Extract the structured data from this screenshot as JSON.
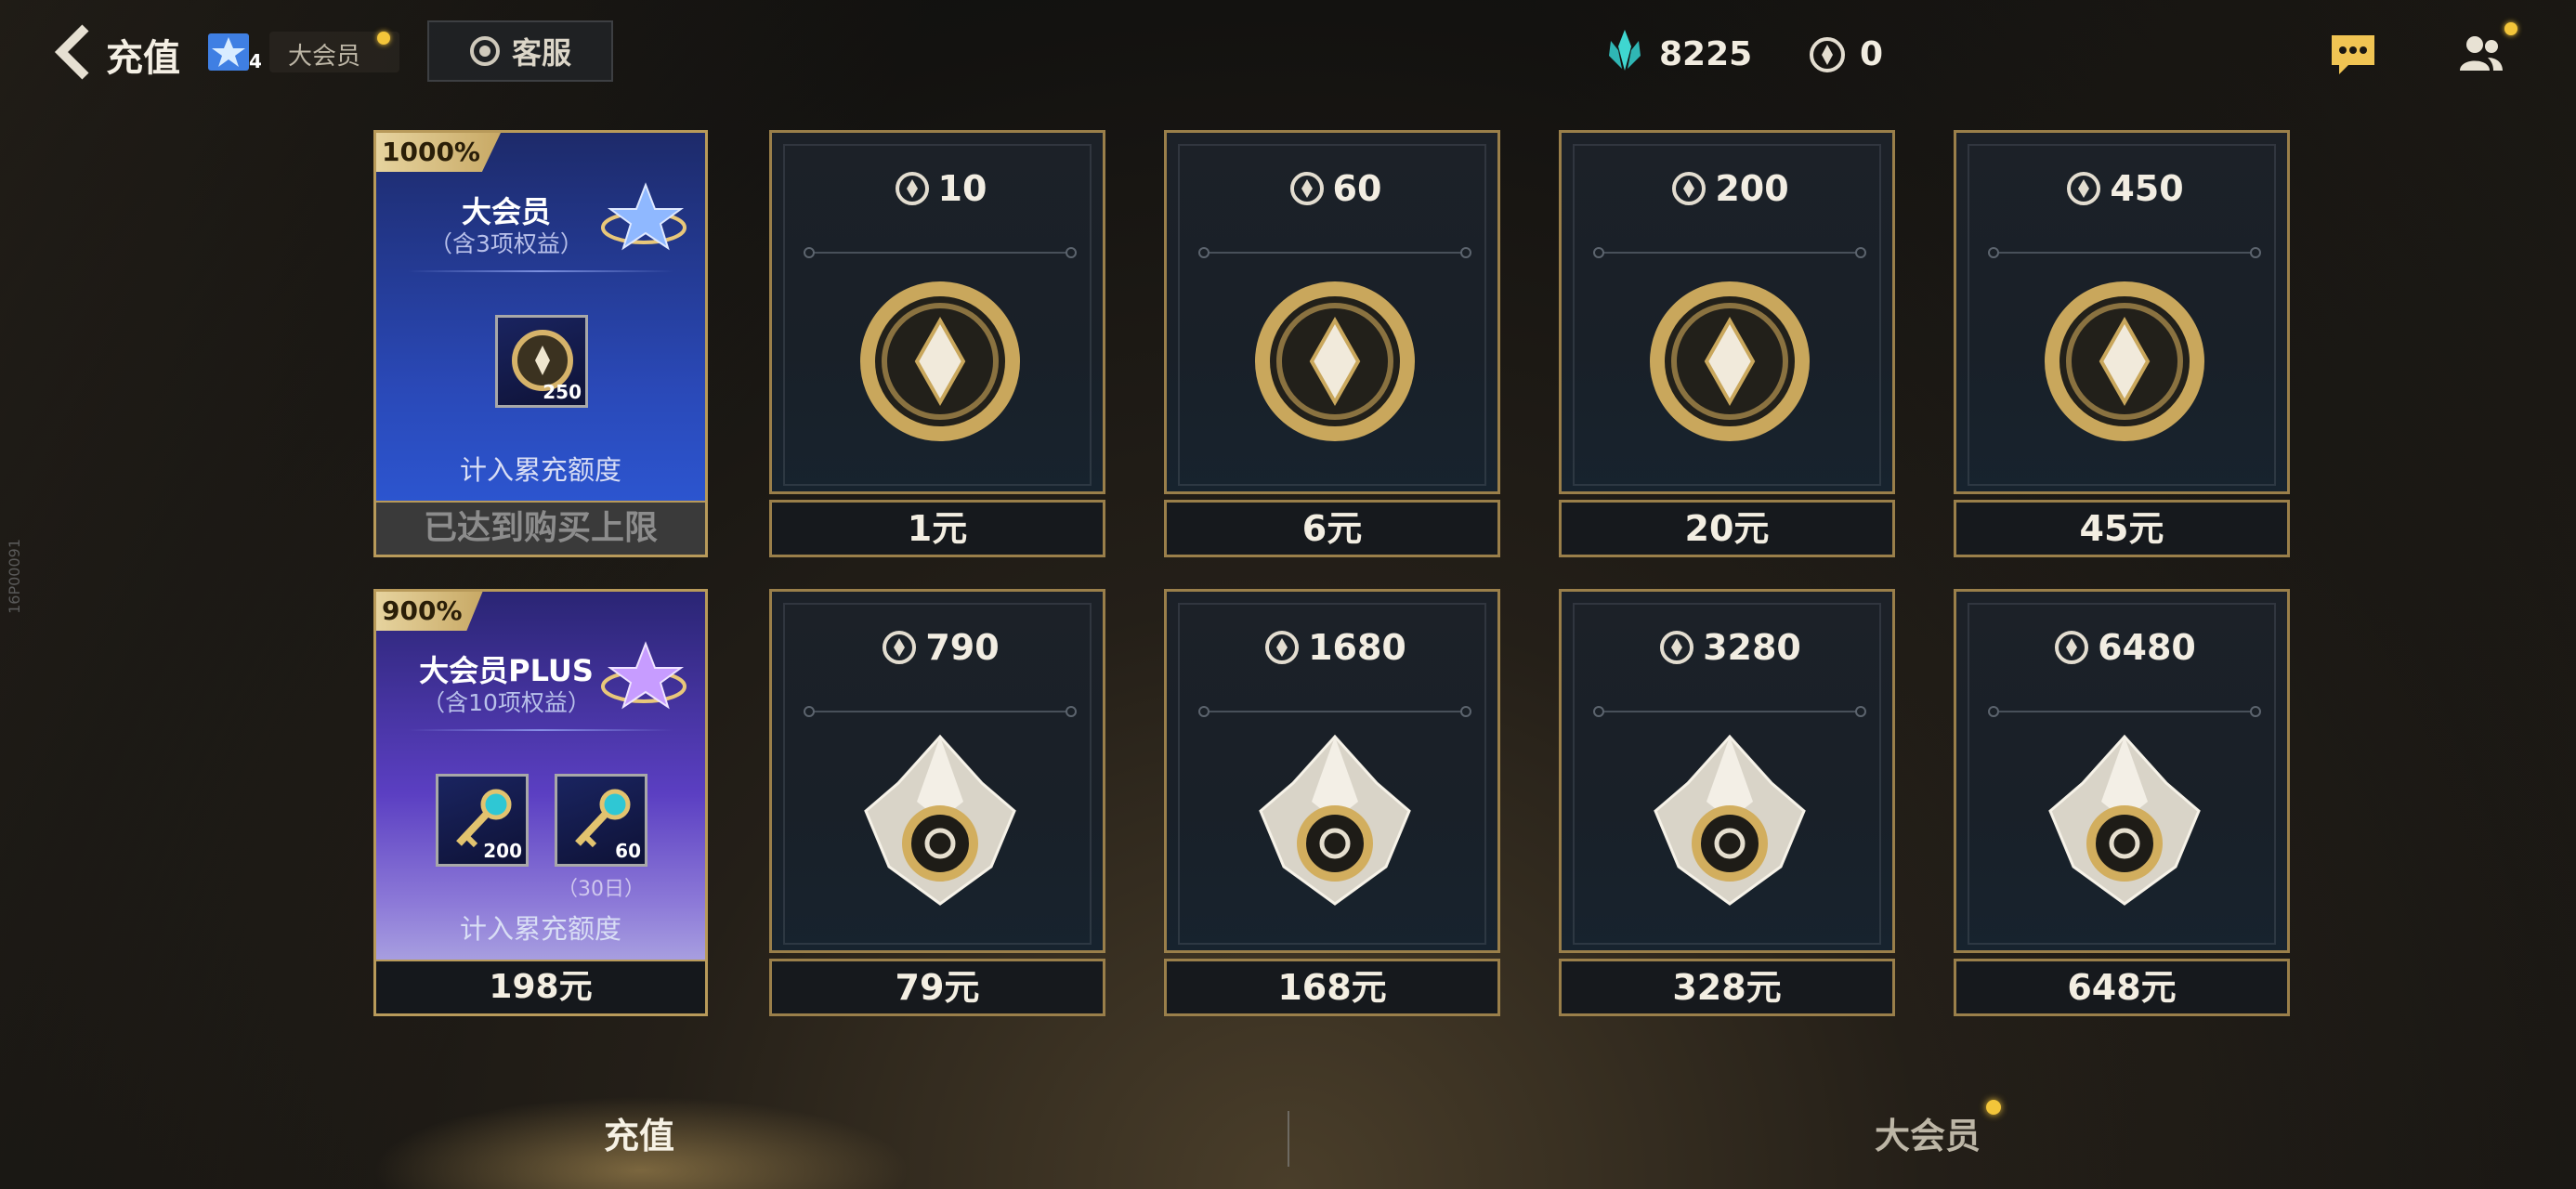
{
  "header": {
    "title": "充值",
    "vip_level": "4",
    "vip_label": "大会员",
    "service_label": "客服",
    "gem_count": "8225",
    "coupon_count": "0"
  },
  "side_id": "16P00091",
  "memberships": [
    {
      "bonus": "1000%",
      "title": "大会员",
      "subtitle": "（含3项权益）",
      "items": [
        {
          "name": "coupon",
          "count": "250"
        }
      ],
      "tally": "计入累充额度",
      "price": "已达到购买上限",
      "status": "limit-reached"
    },
    {
      "bonus": "900%",
      "title": "大会员PLUS",
      "subtitle": "（含10项权益）",
      "items": [
        {
          "name": "key",
          "count": "200"
        },
        {
          "name": "key",
          "count": "60"
        }
      ],
      "duration": "（30日）",
      "tally": "计入累充额度",
      "price": "198元"
    }
  ],
  "recharge_options": [
    {
      "amount": "10",
      "price": "1元",
      "icon": "coin-icon"
    },
    {
      "amount": "60",
      "price": "6元",
      "icon": "coin-icon"
    },
    {
      "amount": "200",
      "price": "20元",
      "icon": "coin-icon"
    },
    {
      "amount": "450",
      "price": "45元",
      "icon": "coin-icon"
    },
    {
      "amount": "790",
      "price": "79元",
      "icon": "crystal-icon"
    },
    {
      "amount": "1680",
      "price": "168元",
      "icon": "crystal-icon"
    },
    {
      "amount": "3280",
      "price": "328元",
      "icon": "crystal-icon"
    },
    {
      "amount": "6480",
      "price": "648元",
      "icon": "crystal-icon"
    }
  ],
  "tabs": [
    {
      "label": "充值",
      "active": true
    },
    {
      "label": "大会员",
      "active": false,
      "has_notification": true
    }
  ],
  "colors": {
    "gold_border": "#9a7f4a",
    "notification_dot": "#f3c53a",
    "gem_teal": "#3fd6d0"
  }
}
